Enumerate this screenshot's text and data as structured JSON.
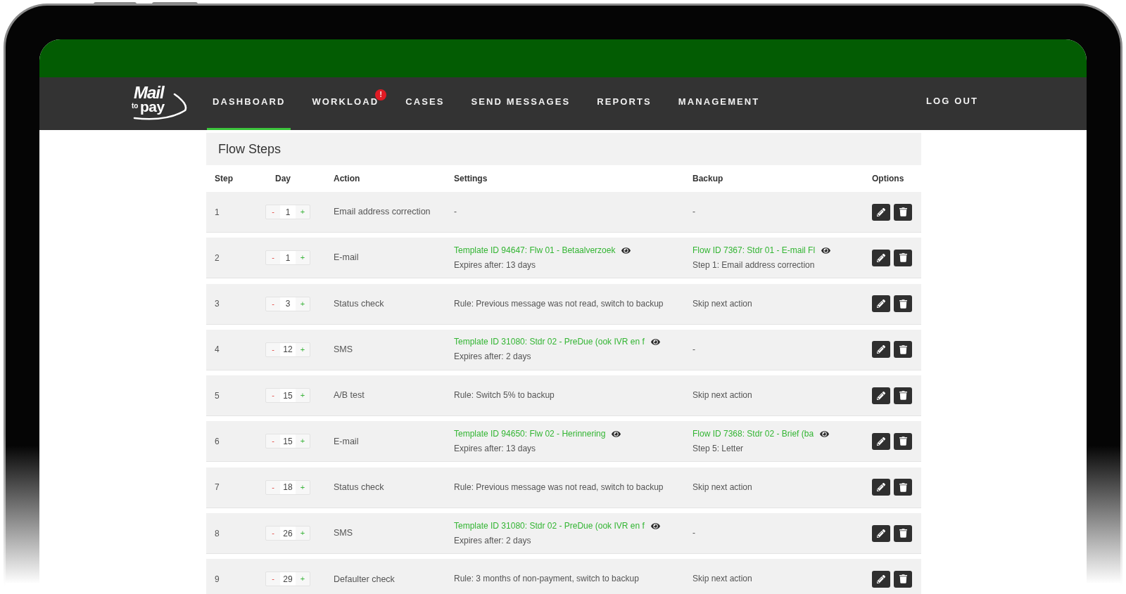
{
  "logo": {
    "top": "Mail",
    "small": "to",
    "bottom": "pay"
  },
  "nav": {
    "items": [
      {
        "label": "DASHBOARD",
        "selected": true
      },
      {
        "label": "WORKLOAD",
        "selected": false,
        "badge": "!"
      },
      {
        "label": "CASES",
        "selected": false
      },
      {
        "label": "SEND MESSAGES",
        "selected": false
      },
      {
        "label": "REPORTS",
        "selected": false
      },
      {
        "label": "MANAGEMENT",
        "selected": false
      }
    ],
    "logout": "LOG OUT"
  },
  "panel": {
    "title": "Flow Steps",
    "columns": [
      "Step",
      "Day",
      "Action",
      "Settings",
      "Backup",
      "Options"
    ],
    "rows": [
      {
        "step": "1",
        "day": {
          "minus": "-",
          "value": "1",
          "plus": "+"
        },
        "action": "Email address correction",
        "settings": [
          {
            "kind": "text",
            "text": "-"
          }
        ],
        "backup": [
          {
            "kind": "text",
            "text": "-"
          }
        ]
      },
      {
        "step": "2",
        "day": {
          "minus": "-",
          "value": "1",
          "plus": "+"
        },
        "action": "E-mail",
        "settings": [
          {
            "kind": "link",
            "text": "Template ID 94647: Flw 01 - Betaalverzoek"
          },
          {
            "kind": "text",
            "text": "Expires after: 13 days"
          }
        ],
        "backup": [
          {
            "kind": "link",
            "text": "Flow ID 7367: Stdr 01 - E-mail Fl"
          },
          {
            "kind": "text",
            "text": "Step 1: Email address correction"
          }
        ]
      },
      {
        "step": "3",
        "day": {
          "minus": "-",
          "value": "3",
          "plus": "+"
        },
        "action": "Status check",
        "settings": [
          {
            "kind": "text",
            "text": "Rule: Previous message was not read, switch to backup"
          }
        ],
        "backup": [
          {
            "kind": "text",
            "text": "Skip next action"
          }
        ]
      },
      {
        "step": "4",
        "day": {
          "minus": "-",
          "value": "12",
          "plus": "+"
        },
        "action": "SMS",
        "settings": [
          {
            "kind": "link",
            "text": "Template ID 31080: Stdr 02 - PreDue (ook IVR en f"
          },
          {
            "kind": "text",
            "text": "Expires after: 2 days"
          }
        ],
        "backup": [
          {
            "kind": "text",
            "text": "-"
          }
        ]
      },
      {
        "step": "5",
        "day": {
          "minus": "-",
          "value": "15",
          "plus": "+"
        },
        "action": "A/B test",
        "settings": [
          {
            "kind": "text",
            "text": "Rule: Switch 5% to backup"
          }
        ],
        "backup": [
          {
            "kind": "text",
            "text": "Skip next action"
          }
        ]
      },
      {
        "step": "6",
        "day": {
          "minus": "-",
          "value": "15",
          "plus": "+"
        },
        "action": "E-mail",
        "settings": [
          {
            "kind": "link",
            "text": "Template ID 94650: Flw 02 - Herinnering"
          },
          {
            "kind": "text",
            "text": "Expires after: 13 days"
          }
        ],
        "backup": [
          {
            "kind": "link",
            "text": "Flow ID 7368: Stdr 02 - Brief (ba"
          },
          {
            "kind": "text",
            "text": "Step 5: Letter"
          }
        ]
      },
      {
        "step": "7",
        "day": {
          "minus": "-",
          "value": "18",
          "plus": "+"
        },
        "action": "Status check",
        "settings": [
          {
            "kind": "text",
            "text": "Rule: Previous message was not read, switch to backup"
          }
        ],
        "backup": [
          {
            "kind": "text",
            "text": "Skip next action"
          }
        ]
      },
      {
        "step": "8",
        "day": {
          "minus": "-",
          "value": "26",
          "plus": "+"
        },
        "action": "SMS",
        "settings": [
          {
            "kind": "link",
            "text": "Template ID 31080: Stdr 02 - PreDue (ook IVR en f"
          },
          {
            "kind": "text",
            "text": "Expires after: 2 days"
          }
        ],
        "backup": [
          {
            "kind": "text",
            "text": "-"
          }
        ]
      },
      {
        "step": "9",
        "day": {
          "minus": "-",
          "value": "29",
          "plus": "+"
        },
        "action": "Defaulter check",
        "settings": [
          {
            "kind": "text",
            "text": "Rule: 3 months of non-payment, switch to backup"
          }
        ],
        "backup": [
          {
            "kind": "text",
            "text": "Skip next action"
          }
        ]
      }
    ]
  }
}
